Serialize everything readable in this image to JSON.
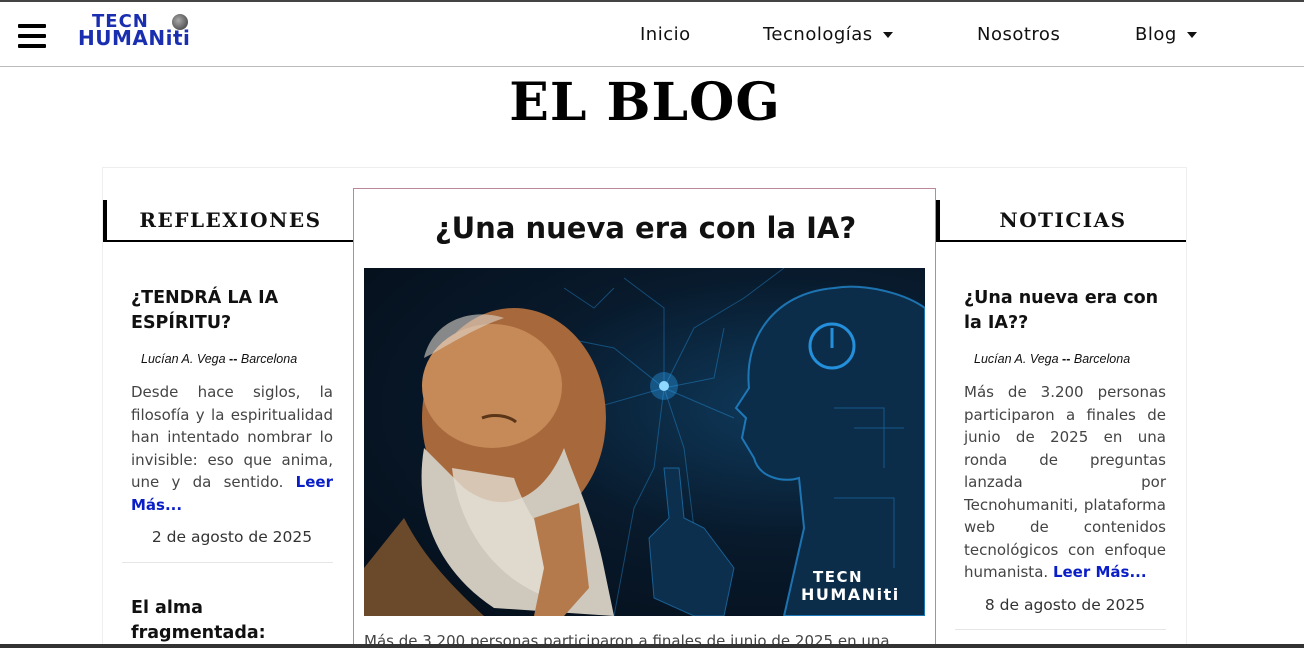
{
  "header": {
    "logo_line1": "TECN",
    "logo_line2": "HUMANiti",
    "nav": [
      {
        "label": "Inicio",
        "dropdown": false
      },
      {
        "label": "Tecnologías",
        "dropdown": true
      },
      {
        "label": "Nosotros",
        "dropdown": false
      },
      {
        "label": "Blog",
        "dropdown": true
      }
    ]
  },
  "page": {
    "title": "EL BLOG"
  },
  "left": {
    "heading": "REFLEXIONES",
    "post1": {
      "title": "¿TENDRÁ LA IA ESPÍRITU?",
      "author": "Lucían A. Vega",
      "dash": "--",
      "city": "Barcelona",
      "excerpt": "Desde hace siglos, la filosofía y la espiritualidad han intentado nombrar lo invisible: eso que anima, une y da sentido.",
      "read_more": "Leer Más...",
      "date": "2 de agosto de 2025"
    },
    "post2": {
      "title": "El alma fragmentada: identidad y emoción"
    }
  },
  "featured": {
    "title": "¿Una nueva era con la IA?",
    "image_watermark_line1": "TECN",
    "image_watermark_line2": "HUMANiti",
    "excerpt": "Más de 3.200 personas participaron a finales de junio de 2025 en una"
  },
  "right": {
    "heading": "NOTICIAS",
    "post1": {
      "title": "¿Una nueva era con la IA??",
      "author": "Lucían A. Vega",
      "dash": "--",
      "city": "Barcelona",
      "excerpt": "Más de 3.200 personas participaron a finales de junio de 2025 en una ronda de preguntas lanzada por Tecnohumaniti, plataforma web de contenidos tecnológicos con enfoque humanista.",
      "read_more": "Leer Más...",
      "date": "8 de agosto de 2025"
    }
  },
  "colors": {
    "brand_blue": "#1a2fb0",
    "read_more": "#0a1ec8",
    "image_glow": "#2aa8ff"
  }
}
